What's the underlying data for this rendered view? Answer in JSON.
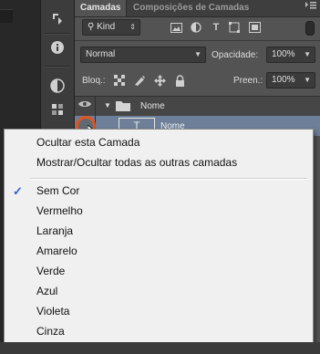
{
  "panel": {
    "tabs": [
      "Camadas",
      "Composições de Camadas"
    ],
    "menu_icon": "panel-menu-icon",
    "filter_kind": "Kind",
    "blend_mode": "Normal",
    "opacity_label": "Opacidade:",
    "opacity_value": "100%",
    "lock_label": "Bloq.:",
    "fill_label": "Preen.:",
    "fill_value": "100%",
    "layers_header_name": "Nome",
    "layer_name": "Nome"
  },
  "context_menu": {
    "group1": [
      "Ocultar esta Camada",
      "Mostrar/Ocultar todas as outras camadas"
    ],
    "colors": [
      "Sem Cor",
      "Vermelho",
      "Laranja",
      "Amarelo",
      "Verde",
      "Azul",
      "Violeta",
      "Cinza"
    ],
    "checked": "Sem Cor",
    "check_glyph": "✓"
  },
  "colors": {
    "accent_cursor": "#e0551f",
    "check_blue": "#2f63c8",
    "selected_layer": "#6d7f99"
  }
}
